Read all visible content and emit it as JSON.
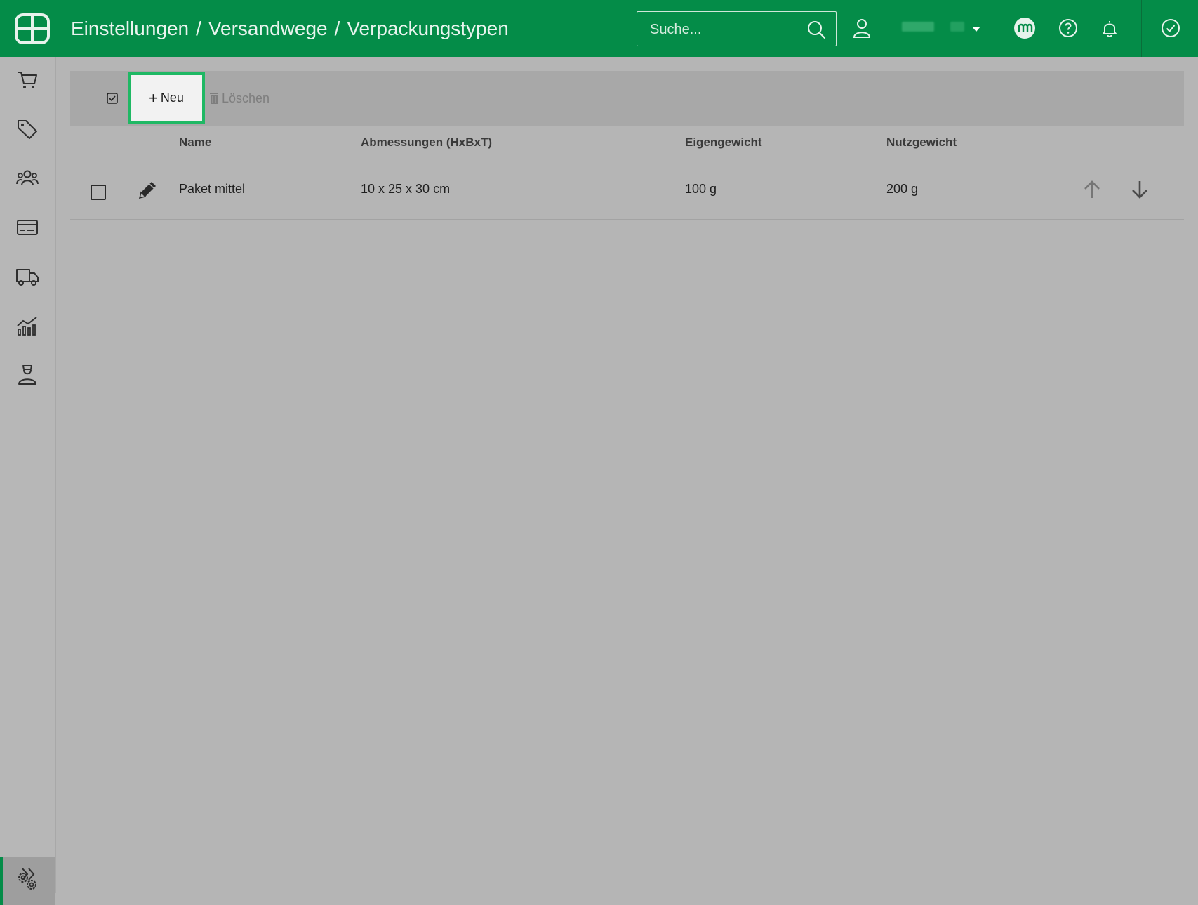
{
  "header": {
    "breadcrumb": [
      "Einstellungen",
      "Versandwege",
      "Verpackungstypen"
    ],
    "separator": "/",
    "search_placeholder": "Suche..."
  },
  "toolbar": {
    "new_label": "Neu",
    "delete_label": "Löschen"
  },
  "table": {
    "columns": [
      "Name",
      "Abmessungen (HxBxT)",
      "Eigengewicht",
      "Nutzgewicht"
    ],
    "rows": [
      {
        "name": "Paket mittel",
        "dimensions": "10 x 25 x 30 cm",
        "own_weight": "100 g",
        "payload": "200 g"
      }
    ]
  },
  "icons": {
    "sidebar": [
      "cart-icon",
      "tag-icon",
      "users-icon",
      "card-icon",
      "truck-icon",
      "chart-icon",
      "agent-icon",
      "settings-icon",
      "expand-icon"
    ],
    "topbar": [
      "search-icon",
      "user-icon",
      "chevron-down-icon",
      "logo-badge-icon",
      "help-icon",
      "bell-icon",
      "check-circle-icon"
    ]
  },
  "colors": {
    "brand_green": "#048c48",
    "highlight_green": "#1fb864"
  }
}
